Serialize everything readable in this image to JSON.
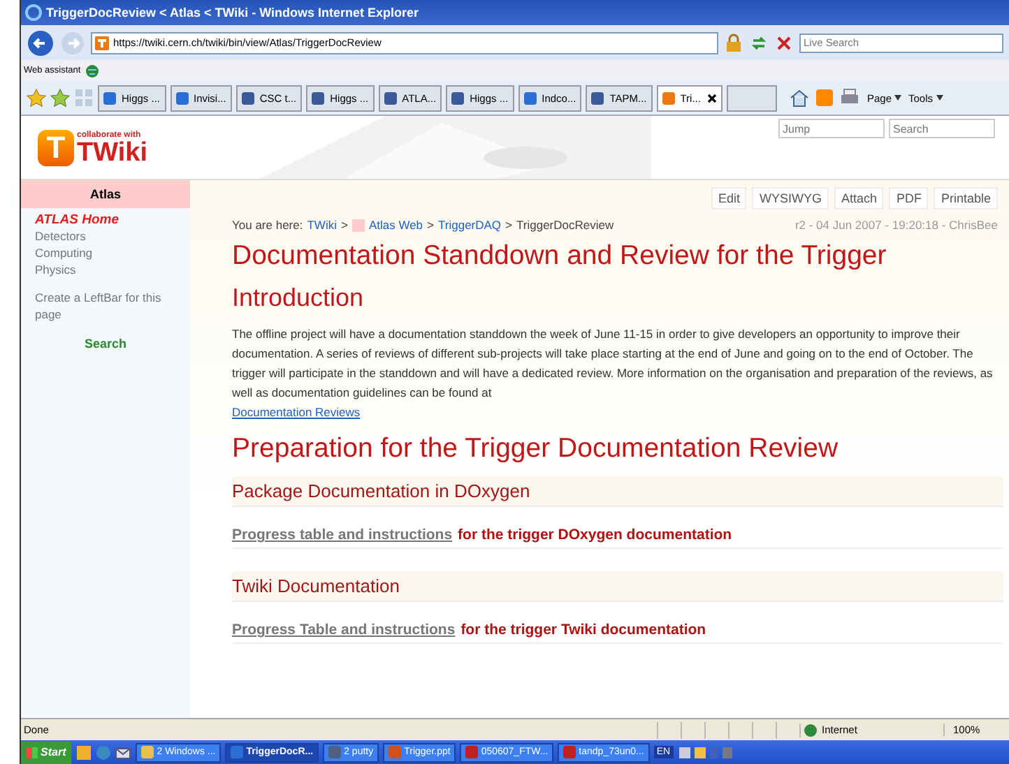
{
  "window": {
    "title": "TriggerDocReview < Atlas < TWiki - Windows Internet Explorer"
  },
  "address_bar": {
    "url": "https://twiki.cern.ch/twiki/bin/view/Atlas/TriggerDocReview",
    "search_placeholder": "Live Search"
  },
  "links_bar": {
    "label": "Web assistant"
  },
  "tabs": [
    {
      "label": "Higgs ...",
      "kind": "ie",
      "selected": false
    },
    {
      "label": "Invisi...",
      "kind": "ie",
      "selected": false
    },
    {
      "label": "CSC t...",
      "kind": "grid",
      "selected": false
    },
    {
      "label": "Higgs ...",
      "kind": "grid",
      "selected": false
    },
    {
      "label": "ATLA...",
      "kind": "grid",
      "selected": false
    },
    {
      "label": "Higgs ...",
      "kind": "grid",
      "selected": false
    },
    {
      "label": "Indco...",
      "kind": "ie",
      "selected": false
    },
    {
      "label": "TAPM...",
      "kind": "grid",
      "selected": false
    },
    {
      "label": "Tri...",
      "kind": "twiki",
      "selected": true
    }
  ],
  "command_bar": [
    "Page",
    "Tools"
  ],
  "twiki": {
    "logo_letter": "T",
    "logo_tagline": "collaborate with",
    "logo_name": "TWiki",
    "jump_placeholder": "Jump",
    "search_placeholder": "Search",
    "sidebar": {
      "title": "Atlas",
      "items": [
        {
          "label": "ATLAS Home",
          "kind": "home"
        },
        {
          "label": "Detectors",
          "kind": "link"
        },
        {
          "label": "Computing",
          "kind": "link"
        },
        {
          "label": "Physics",
          "kind": "link"
        }
      ],
      "create": "Create a LeftBar for this page",
      "search": "Search"
    },
    "actions": [
      "Edit",
      "WYSIWYG",
      "Attach",
      "PDF",
      "Printable"
    ],
    "breadcrumb": {
      "prefix": "You are here:",
      "separator": ">",
      "items": [
        {
          "label": "TWiki",
          "kind": "link"
        },
        {
          "label": "Atlas Web",
          "kind": "web"
        },
        {
          "label": "TriggerDAQ",
          "kind": "link"
        },
        {
          "label": "TriggerDocReview",
          "kind": "current"
        }
      ]
    },
    "revision": "r2 - 04 Jun 2007 - 19:20:18 - ChrisBee",
    "content": [
      {
        "kind": "h1",
        "text": "Documentation Standdown and Review for the Trigger"
      },
      {
        "kind": "h2",
        "text": "Introduction"
      },
      {
        "kind": "para",
        "text": "The offline project will have a documentation standdown the week of June 11-15 in order to give developers an opportunity to improve their documentation. A series of reviews of different sub-projects will take place starting at the end of June and going on to the end of October. The trigger will participate in the standdown and will have a dedicated review. More information on the organisation and preparation of the reviews, as well as documentation guidelines can be found at",
        "link": "Documentation Reviews"
      },
      {
        "kind": "h1",
        "text": "Preparation for the Trigger Documentation Review"
      },
      {
        "kind": "h3",
        "text": "Package Documentation in DOxygen"
      },
      {
        "kind": "linkline",
        "link": "Progress table and instructions",
        "text": "for the trigger DOxygen documentation"
      },
      {
        "kind": "h3",
        "text": "Twiki Documentation"
      },
      {
        "kind": "linkline",
        "link": "Progress Table and instructions",
        "text": "for the trigger Twiki documentation"
      }
    ]
  },
  "status_bar": {
    "text": "Done",
    "zone": "Internet",
    "zoom": "100%"
  },
  "taskbar": {
    "start": "Start",
    "items": [
      {
        "label": "2 Windows ...",
        "kind": "folder",
        "selected": false
      },
      {
        "label": "TriggerDocR...",
        "kind": "ie",
        "selected": true
      },
      {
        "label": "2 putty",
        "kind": "putty",
        "selected": false
      },
      {
        "label": "Trigger.ppt",
        "kind": "ppt",
        "selected": false
      },
      {
        "label": "050607_FTW...",
        "kind": "pdf",
        "selected": false
      },
      {
        "label": "tandp_73un0...",
        "kind": "pdf",
        "selected": false
      }
    ],
    "language": "EN"
  }
}
